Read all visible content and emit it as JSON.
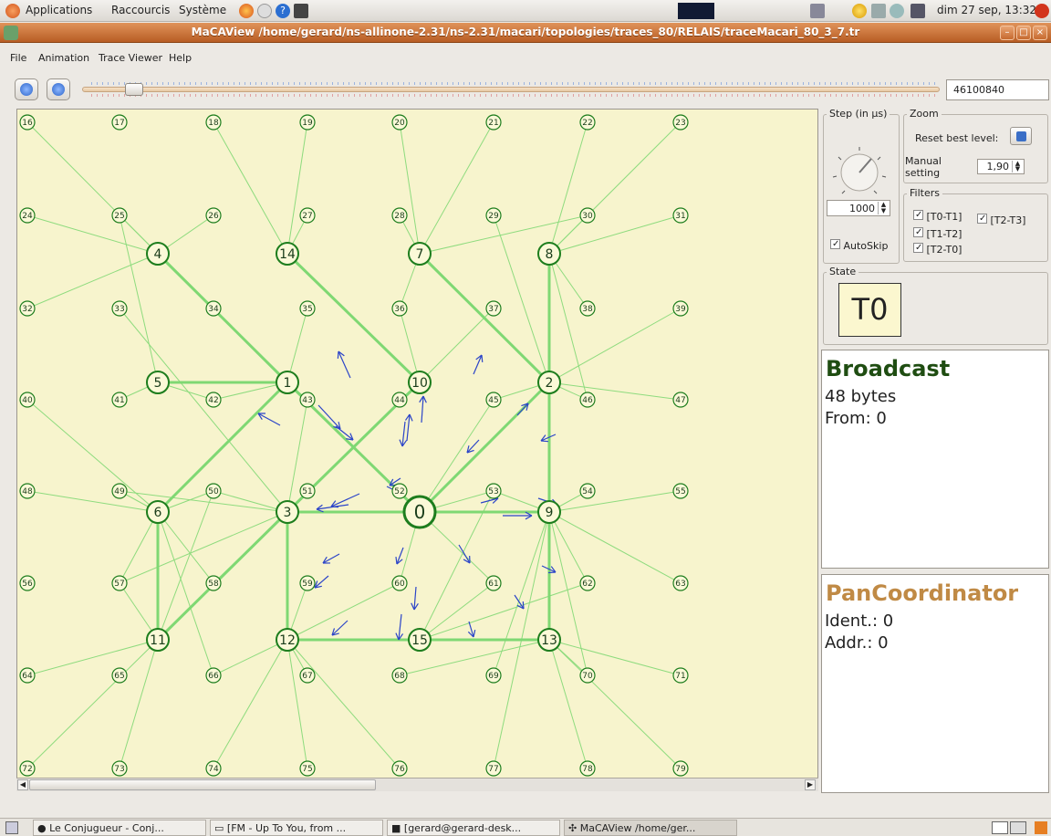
{
  "panel": {
    "applications": "Applications",
    "shortcuts": "Raccourcis",
    "system": "Système",
    "clock": "dim 27 sep, 13:32"
  },
  "window": {
    "title": "MaCAView /home/gerard/ns-allinone-2.31/ns-2.31/macari/topologies/traces_80/RELAIS/traceMacari_80_3_7.tr"
  },
  "menubar": {
    "file": "File",
    "animation": "Animation",
    "trace_viewer": "Trace Viewer",
    "help": "Help"
  },
  "toolbar": {
    "time_value": "46100840"
  },
  "step": {
    "title": "Step (in µs)",
    "value": "1000",
    "autoskip_label": "AutoSkip"
  },
  "zoom": {
    "title": "Zoom",
    "reset_label": "Reset best level:",
    "manual_label_1": "Manual",
    "manual_label_2": "setting",
    "manual_value": "1,90"
  },
  "filters": {
    "title": "Filters",
    "t0_t1": "[T0-T1]",
    "t2_t3": "[T2-T3]",
    "t1_t2": "[T1-T2]",
    "t2_t0": "[T2-T0]"
  },
  "state": {
    "title": "State",
    "value": "T0"
  },
  "broadcast": {
    "heading": "Broadcast",
    "size": "48 bytes",
    "from": "From: 0",
    "color": "#1f4d12"
  },
  "coordinator": {
    "heading": "PanCoordinator",
    "ident": "Ident.: 0",
    "addr": "Addr.: 0",
    "color": "#c08a45"
  },
  "taskbar": {
    "task1": "Le Conjugueur - Conj...",
    "task2": "[FM - Up To You, from ...",
    "task3": "[gerard@gerard-desk...",
    "task4": "MaCAView /home/ger..."
  },
  "network": {
    "node_labels": [
      "0",
      "1",
      "2",
      "3",
      "4",
      "5",
      "6",
      "7",
      "8",
      "9",
      "10",
      "11",
      "12",
      "13",
      "14",
      "15",
      "16",
      "17",
      "18",
      "19",
      "20",
      "21",
      "22",
      "23",
      "24",
      "25",
      "26",
      "27",
      "28",
      "29",
      "30",
      "31",
      "32",
      "33",
      "34",
      "35",
      "36",
      "37",
      "38",
      "39",
      "40",
      "41",
      "42",
      "43",
      "44",
      "45",
      "46",
      "47",
      "48",
      "49",
      "50",
      "51",
      "52",
      "53",
      "54",
      "55",
      "56",
      "57",
      "58",
      "59",
      "60",
      "61",
      "62",
      "63",
      "64",
      "65",
      "66",
      "67",
      "68",
      "69",
      "70",
      "71",
      "72",
      "73",
      "74",
      "75",
      "76",
      "77",
      "78",
      "79"
    ]
  }
}
